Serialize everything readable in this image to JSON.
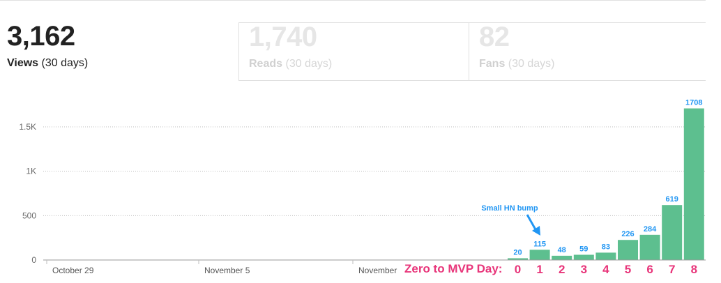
{
  "stats": {
    "views": {
      "value": "3,162",
      "label": "Views",
      "period": "(30 days)"
    },
    "reads": {
      "value": "1,740",
      "label": "Reads",
      "period": "(30 days)"
    },
    "fans": {
      "value": "82",
      "label": "Fans",
      "period": "(30 days)"
    }
  },
  "colors": {
    "bar": "#5dbf8f",
    "annotation_blue": "#2196f3",
    "annotation_pink": "#e8357a"
  },
  "chart_data": {
    "type": "bar",
    "y_ticks": [
      "0",
      "500",
      "1K",
      "1.5K"
    ],
    "y_tick_values": [
      0,
      500,
      1000,
      1500
    ],
    "ylim": [
      0,
      1700
    ],
    "x_labels": [
      "October 29",
      "November 5",
      "November"
    ],
    "values": [
      20,
      115,
      48,
      59,
      83,
      226,
      284,
      619,
      1708
    ],
    "bar_labels": [
      "20",
      "115",
      "48",
      "59",
      "83",
      "226",
      "284",
      "619",
      "1708"
    ],
    "grid": true
  },
  "annotations": {
    "hn": "Small HN bump",
    "mvp_label": "Zero to MVP Day:",
    "days": [
      "0",
      "1",
      "2",
      "3",
      "4",
      "5",
      "6",
      "7",
      "8"
    ]
  }
}
